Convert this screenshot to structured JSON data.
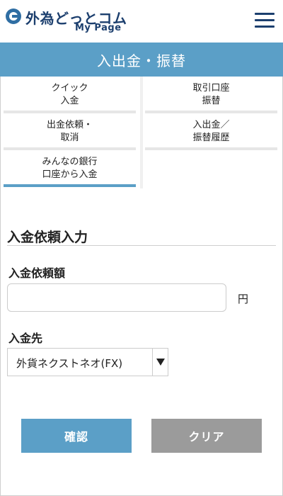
{
  "header": {
    "logo_text": "外為どっとコム",
    "logo_sub": "My Page"
  },
  "title": "入出金・振替",
  "tiles": [
    {
      "label": "クイック\n入金"
    },
    {
      "label": "取引口座\n振替"
    },
    {
      "label": "出金依頼・\n取消"
    },
    {
      "label": "入出金／\n振替履歴"
    },
    {
      "label": "みんなの銀行\n口座から入金"
    }
  ],
  "form": {
    "section_title": "入金依頼入力",
    "amount_label": "入金依頼額",
    "amount_value": "",
    "amount_unit": "円",
    "destination_label": "入金先",
    "destination_value": "外貨ネクストネオ(FX)"
  },
  "buttons": {
    "confirm": "確認",
    "clear": "クリア"
  },
  "colors": {
    "accent": "#5b9fc7",
    "brand": "#1c3f6e",
    "clear_button": "#9b9b9b"
  }
}
